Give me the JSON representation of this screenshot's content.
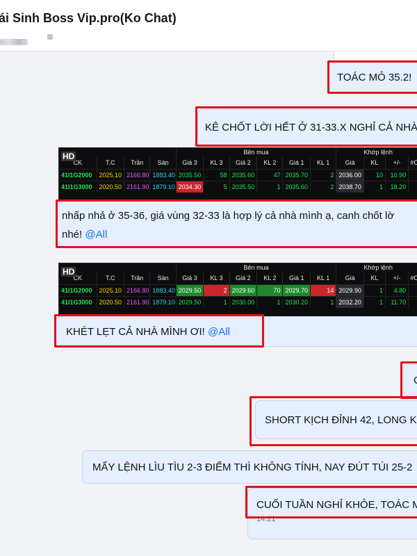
{
  "header": {
    "title": "ái Sinh Boss Vip.pro(Ko Chat)"
  },
  "messages": {
    "m1": {
      "text": "TOÁC MỎ 35.2!"
    },
    "m2": {
      "text": "KÊ CHỐT LỜI HẾT Ở 31-33.X NGHỈ CẢ NHÀ"
    },
    "m3": {
      "line1": "nhấp nhả ở 35-36, giá vùng 32-33 là hợp lý cả nhà mình ạ, canh chốt lờ",
      "line2": "nhé!",
      "mention": "@All"
    },
    "m4": {
      "text": "KHÉT LẸT CẢ NHÀ MÌNH ƠI!",
      "mention": "@All"
    },
    "m5": {
      "text": "C"
    },
    "m6": {
      "text": "SHORT KỊCH ĐỈNH 42, LONG K"
    },
    "m7": {
      "text": "MẤY LỆNH LÌU TÌU 2-3 ĐIỂM THÌ KHÔNG TÍNH, NAY ĐÚT TÚI 25-2"
    },
    "m8": {
      "text": "CUỐI TUẦN NGHỈ KHỎE, TOÁC M",
      "time": "14:21"
    }
  },
  "stock_table": {
    "badge": "HD",
    "group_headers": {
      "buy": "Bên mua",
      "match": "Khớp lệnh"
    },
    "columns": [
      "CK",
      "T.C",
      "Trần",
      "Sàn",
      "Giá 3",
      "KL 3",
      "Giá 2",
      "KL 2",
      "Giá 1",
      "KL 1",
      "Giá",
      "KL",
      "+/-",
      "#C"
    ],
    "snapshot1": [
      [
        "41I1G2000",
        "2025.10",
        "2166.80",
        "1883.40",
        "2035.50",
        "58",
        "2035.60",
        "47",
        "2035.70",
        "2",
        "2036.00",
        "10",
        "10.90",
        ""
      ],
      [
        "41I1G3000",
        "2020.50",
        "2161.90",
        "1879.10",
        "2034.30",
        "5",
        "2035.50",
        "1",
        "2035.60",
        "2",
        "2038.70",
        "1",
        "18.20",
        ""
      ]
    ],
    "snapshot2": [
      [
        "41I1G2000",
        "2025.10",
        "2166.80",
        "1883.40",
        "2029.50",
        "2",
        "2029.60",
        "70",
        "2029.70",
        "14",
        "2029.90",
        "1",
        "4.80",
        ""
      ],
      [
        "41I1G3000",
        "2020.50",
        "2161.90",
        "1879.10",
        "2029.50",
        "1",
        "2030.00",
        "1",
        "2030.20",
        "1",
        "2032.20",
        "1",
        "11.70",
        ""
      ]
    ]
  },
  "colors": {
    "accent_red": "#e0121b",
    "bubble": "#e5efff",
    "mention": "#1a6ff0",
    "up_green": "#1ee650"
  }
}
